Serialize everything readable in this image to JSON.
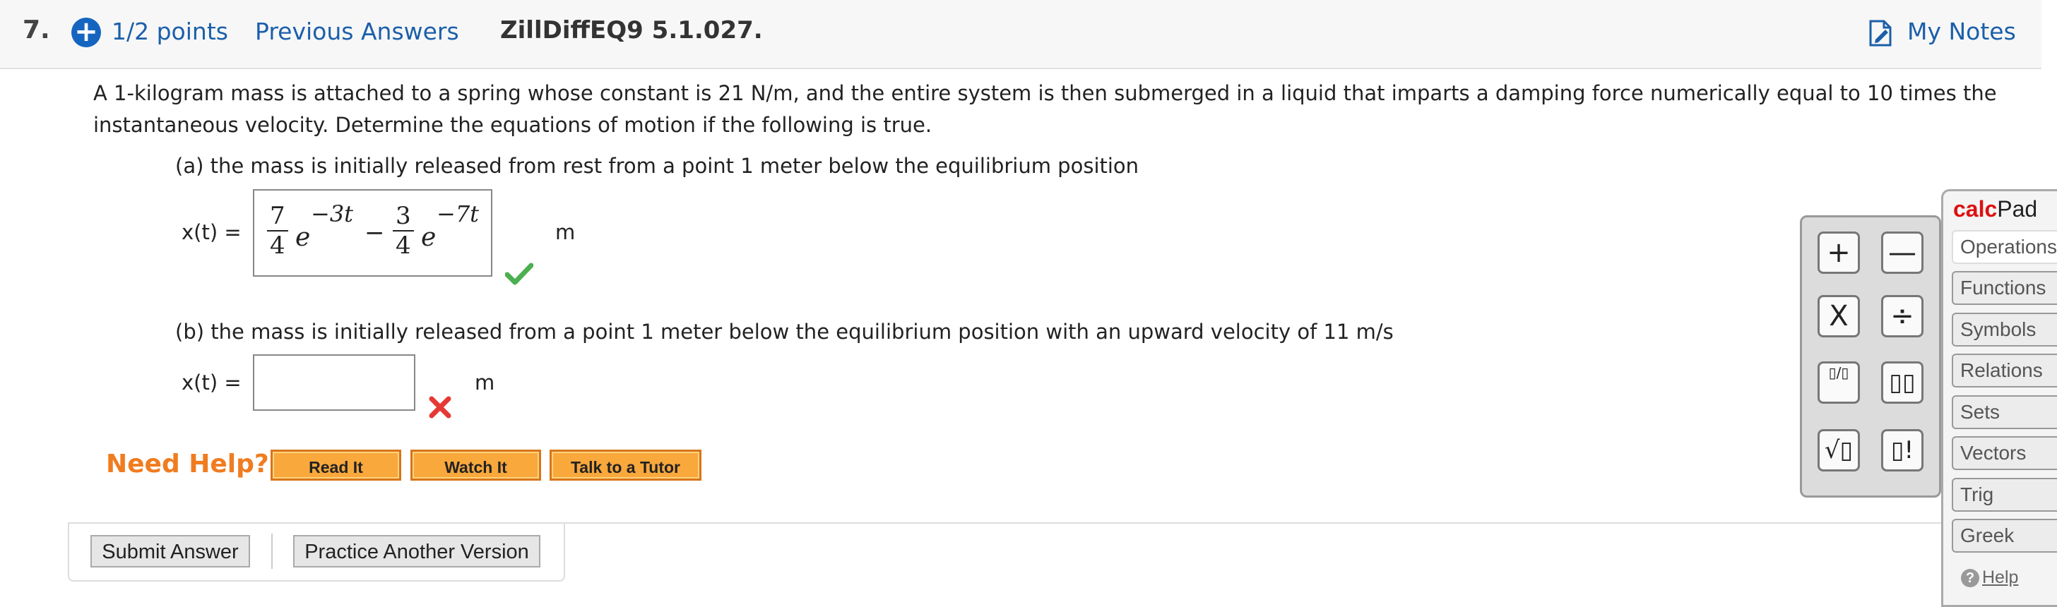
{
  "header": {
    "question_number": "7.",
    "points": "1/2 points",
    "previous_answers": "Previous Answers",
    "question_id": "ZillDiffEQ9 5.1.027.",
    "my_notes": "My Notes"
  },
  "problem": {
    "text": "A 1-kilogram mass is attached to a spring whose constant is 21 N/m, and the entire system is then submerged in a liquid that imparts a damping force numerically equal to 10 times the instantaneous velocity. Determine the equations of motion if the following is true.",
    "part_a": {
      "prompt": "(a) the mass is initially released from rest from a point 1 meter below the equilibrium position",
      "label": "x(t) =",
      "answer": {
        "term1_num": "7",
        "term1_den": "4",
        "term1_base": "e",
        "term1_exp": "−3t",
        "operator": "−",
        "term2_num": "3",
        "term2_den": "4",
        "term2_base": "e",
        "term2_exp": "−7t"
      },
      "unit": "m",
      "status": "correct"
    },
    "part_b": {
      "prompt": "(b) the mass is initially released from a point 1 meter below the equilibrium position with an upward velocity of 11 m/s",
      "label": "x(t) =",
      "answer": "",
      "unit": "m",
      "status": "incorrect"
    }
  },
  "help": {
    "label": "Need Help?",
    "buttons": [
      "Read It",
      "Watch It",
      "Talk to a Tutor"
    ]
  },
  "actions": {
    "submit": "Submit Answer",
    "practice": "Practice Another Version"
  },
  "keypad": {
    "keys": [
      "+",
      "—",
      "X",
      "÷",
      "▯/▯",
      "▯▯",
      "√▯",
      "▯!"
    ]
  },
  "calcpad": {
    "title_bold": "calc",
    "title_rest": "Pad",
    "menu": [
      "Operations",
      "Functions",
      "Symbols",
      "Relations",
      "Sets",
      "Vectors",
      "Trig",
      "Greek"
    ],
    "help": "Help"
  },
  "colors": {
    "link": "#1b5faa",
    "need_help": "#f07c20",
    "help_button": "#f9a83c",
    "correct": "#4caf50",
    "incorrect": "#e53935"
  }
}
